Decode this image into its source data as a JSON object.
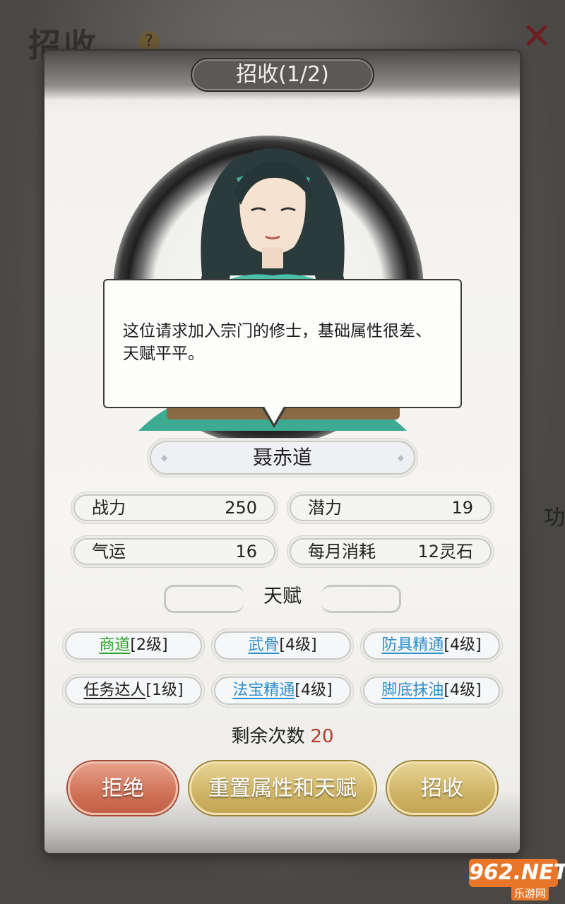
{
  "background": {
    "title": "招收",
    "help_icon": "?",
    "side_text": "功"
  },
  "dialog": {
    "title": "招收(1/2)",
    "speech": "这位请求加入宗门的修士，基础属性很差、天赋平平。",
    "name": "聂赤道",
    "stats": [
      {
        "label": "战力",
        "value": "250"
      },
      {
        "label": "潜力",
        "value": "19"
      },
      {
        "label": "气运",
        "value": "16"
      },
      {
        "label": "每月消耗",
        "value": "12灵石"
      }
    ],
    "talent_header": "天赋",
    "talents": [
      {
        "name": "商道",
        "level": "[2级]",
        "color": "#2fa12f"
      },
      {
        "name": "武骨",
        "level": "[4级]",
        "color": "#2e8fcb"
      },
      {
        "name": "防具精通",
        "level": "[4级]",
        "color": "#2e8fcb"
      },
      {
        "name": "任务达人",
        "level": "[1级]",
        "color": "#1d1d1d"
      },
      {
        "name": "法宝精通",
        "level": "[4级]",
        "color": "#2e8fcb"
      },
      {
        "name": "脚底抹油",
        "level": "[4级]",
        "color": "#2e8fcb"
      }
    ],
    "remaining_label": "剩余次数",
    "remaining_count": "20",
    "buttons": {
      "reject": "拒绝",
      "reset": "重置属性和天赋",
      "recruit": "招收"
    }
  },
  "watermark": {
    "main": "962.NET",
    "sub": "乐游网"
  }
}
